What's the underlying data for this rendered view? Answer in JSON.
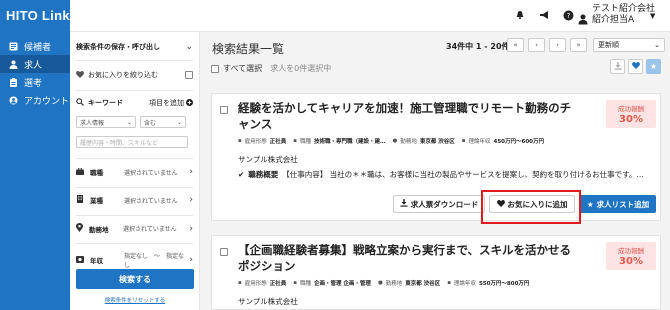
{
  "app": {
    "logo": "HITO Link"
  },
  "topbar": {
    "icons": [
      "bell-icon",
      "megaphone-icon",
      "help-icon",
      "user-icon"
    ],
    "user_company": "テスト紹介会社",
    "user_name": "紹介担当A"
  },
  "sidebar": {
    "items": [
      {
        "label": "候補者",
        "icon": "id-card-icon",
        "active": false
      },
      {
        "label": "求人",
        "icon": "user-icon",
        "active": true
      },
      {
        "label": "選考",
        "icon": "clipboard-icon",
        "active": false
      },
      {
        "label": "アカウント",
        "icon": "account-icon",
        "active": false
      }
    ]
  },
  "filters": {
    "saved_label": "検索条件の保存・呼び出し",
    "fav_label": "お気に入りを絞り込む",
    "keyword_label": "キーワード",
    "add_item_label": "項目を追加",
    "keyword_field_select": "求人情報",
    "keyword_match_select": "含む",
    "keyword_placeholder": "履歴内容・時間、スキルなど",
    "rows": [
      {
        "label": "職種",
        "value": "選択されていません",
        "icon": "briefcase-icon"
      },
      {
        "label": "業種",
        "value": "選択されていません",
        "icon": "building-icon"
      },
      {
        "label": "勤務地",
        "value": "選択されていません",
        "icon": "location-icon"
      },
      {
        "label": "年収",
        "value": "指定なし　〜　指定なし",
        "icon": "yen-icon"
      }
    ],
    "search_button": "検索する",
    "reset_link": "検索条件をリセットする"
  },
  "results": {
    "title": "検索結果一覧",
    "count": "34件中 1 - 20件",
    "pager": [
      "«",
      "‹",
      "›",
      "»"
    ],
    "sort": "更新順",
    "select_all": "すべて選択",
    "selected_count": "求人を0件選択中"
  },
  "cards": [
    {
      "title": "経験を活かしてキャリアを加速！施工管理職でリモート勤務のチャンス",
      "badge_label": "成功報酬",
      "badge_value": "30%",
      "employment_label": "雇用形態",
      "employment": "正社員",
      "job_label": "職種",
      "job": "技術職・専門職（建設・建…",
      "location_label": "勤務地",
      "location": "東京都 渋谷区",
      "salary_label": "理論年収",
      "salary": "450万円〜600万円",
      "company": "サンプル株式会社",
      "summary_label": "職務概要",
      "summary": "【仕事内容】 当社の＊＊職は、お客様に当社の製品やサービスを提案し、契約を取り付けるお仕事です。…",
      "btn_download": "求人票ダウンロード",
      "btn_favorite": "お気に入りに追加",
      "btn_add_list": "求人リスト追加"
    },
    {
      "title": "【企画職経験者募集】戦略立案から実行まで、スキルを活かせるポジション",
      "badge_label": "成功報酬",
      "badge_value": "30%",
      "employment_label": "雇用形態",
      "employment": "正社員",
      "job_label": "職種",
      "job": "企画・管理 企画・管理",
      "location_label": "勤務地",
      "location": "東京都 渋谷区",
      "salary_label": "理論年収",
      "salary": "550万円〜800万円",
      "company": "サンプル株式会社"
    }
  ]
}
